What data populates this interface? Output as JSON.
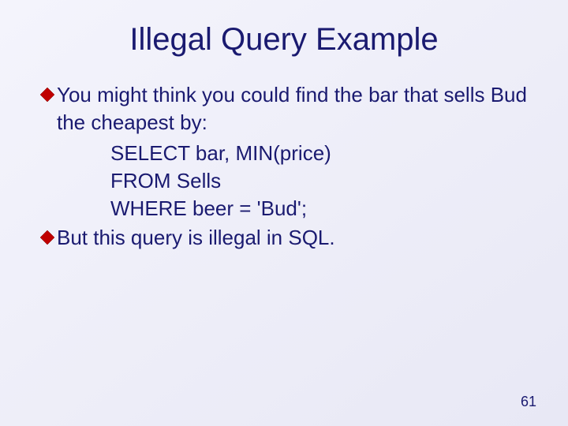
{
  "title": "Illegal Query Example",
  "bullets": {
    "b1": "You might think you could find the bar that sells Bud the cheapest by:",
    "b2": "But this query is illegal in SQL."
  },
  "code": {
    "l1": "SELECT bar, MIN(price)",
    "l2": "FROM Sells",
    "l3": "WHERE beer = 'Bud';"
  },
  "page_number": "61"
}
